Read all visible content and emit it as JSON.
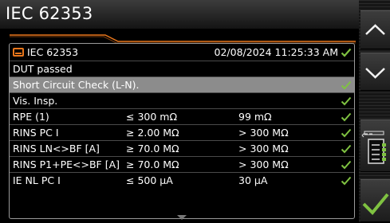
{
  "title": "IEC 62353",
  "header": {
    "icon": "card-icon",
    "name": "IEC 62353",
    "datetime": "02/08/2024 11:25:33 AM",
    "status_icon": "check-icon"
  },
  "rows": [
    {
      "label": "DUT passed",
      "limit": "",
      "value": "",
      "check": false
    },
    {
      "label": "Short Circuit Check (L-N).",
      "limit": "",
      "value": "",
      "check": true,
      "selected": true
    },
    {
      "label": "Vis. Insp.",
      "limit": "",
      "value": "",
      "check": true
    },
    {
      "label": "RPE (1)",
      "limit": "≤ 300 mΩ",
      "value": "99 mΩ",
      "check": true
    },
    {
      "label": "RINS PC I",
      "limit": "≥ 2.00 MΩ",
      "value": "> 300 MΩ",
      "check": true
    },
    {
      "label": "RINS LN<>BF [A]",
      "limit": "≥ 70.0 MΩ",
      "value": "> 300 MΩ",
      "check": true
    },
    {
      "label": "RINS P1+PE<>BF [A]",
      "limit": "≥ 70.0 MΩ",
      "value": "> 300 MΩ",
      "check": true
    },
    {
      "label": "IE NL PC I",
      "limit": "≤ 500 µA",
      "value": "30 µA",
      "check": true
    }
  ],
  "sidebar": {
    "buttons": [
      "scroll-up-icon",
      "scroll-down-icon",
      "report-list-icon",
      "confirm-check-icon"
    ]
  },
  "colors": {
    "accent": "#e8761b",
    "check": "#7fc241",
    "selected_row": "#8c8c8c"
  }
}
